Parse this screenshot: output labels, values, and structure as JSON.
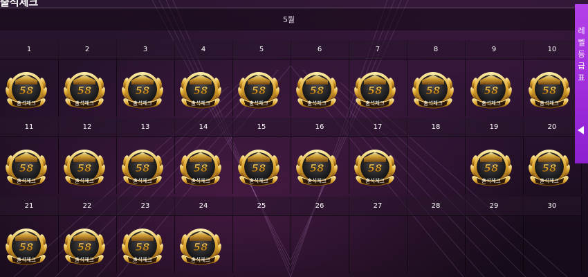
{
  "header": {
    "title": "출석체크"
  },
  "calendar": {
    "month_label": "5월",
    "rows": [
      {
        "days": [
          {
            "day": "1",
            "checked": true
          },
          {
            "day": "2",
            "checked": true
          },
          {
            "day": "3",
            "checked": true
          },
          {
            "day": "4",
            "checked": true
          },
          {
            "day": "5",
            "checked": true
          },
          {
            "day": "6",
            "checked": true
          },
          {
            "day": "7",
            "checked": true
          },
          {
            "day": "8",
            "checked": true
          },
          {
            "day": "9",
            "checked": true
          },
          {
            "day": "10",
            "checked": true
          }
        ]
      },
      {
        "days": [
          {
            "day": "11",
            "checked": true
          },
          {
            "day": "12",
            "checked": true
          },
          {
            "day": "13",
            "checked": true
          },
          {
            "day": "14",
            "checked": true
          },
          {
            "day": "15",
            "checked": true
          },
          {
            "day": "16",
            "checked": true
          },
          {
            "day": "17",
            "checked": true
          },
          {
            "day": "18",
            "checked": false
          },
          {
            "day": "19",
            "checked": true
          },
          {
            "day": "20",
            "checked": true
          }
        ]
      },
      {
        "days": [
          {
            "day": "21",
            "checked": true
          },
          {
            "day": "22",
            "checked": true
          },
          {
            "day": "23",
            "checked": true
          },
          {
            "day": "24",
            "checked": true
          },
          {
            "day": "25",
            "checked": false
          },
          {
            "day": "26",
            "checked": false
          },
          {
            "day": "27",
            "checked": false
          },
          {
            "day": "28",
            "checked": false
          },
          {
            "day": "29",
            "checked": false
          },
          {
            "day": "30",
            "checked": false
          }
        ]
      }
    ],
    "badge": {
      "number": "58",
      "label": "출석체크",
      "icon": "laurel-medal-icon"
    }
  },
  "side_tab": {
    "chars": [
      "레",
      "벨",
      "등",
      "급",
      "표"
    ],
    "arrow_icon": "chevron-left-icon"
  },
  "colors": {
    "accent": "#a23ae0",
    "gold": "#e0b040",
    "background": "#1c0f22"
  }
}
